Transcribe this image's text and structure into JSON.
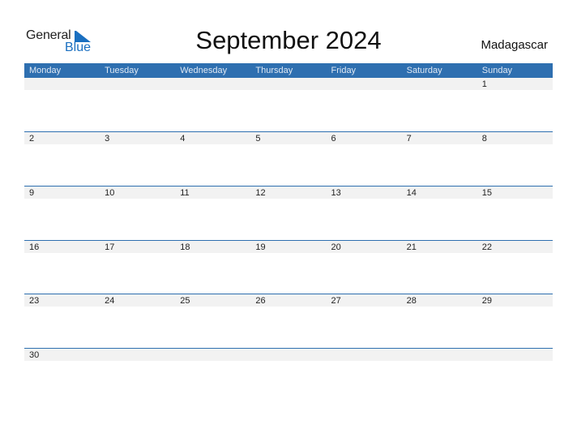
{
  "logo": {
    "line1": "General",
    "line2": "Blue",
    "icon": "triangle-flag-icon",
    "color": "#1a6fc0"
  },
  "title": "September 2024",
  "country": "Madagascar",
  "accent_color": "#2e6fb0",
  "weekdays": [
    "Monday",
    "Tuesday",
    "Wednesday",
    "Thursday",
    "Friday",
    "Saturday",
    "Sunday"
  ],
  "weeks": [
    [
      "",
      "",
      "",
      "",
      "",
      "",
      "1"
    ],
    [
      "2",
      "3",
      "4",
      "5",
      "6",
      "7",
      "8"
    ],
    [
      "9",
      "10",
      "11",
      "12",
      "13",
      "14",
      "15"
    ],
    [
      "16",
      "17",
      "18",
      "19",
      "20",
      "21",
      "22"
    ],
    [
      "23",
      "24",
      "25",
      "26",
      "27",
      "28",
      "29"
    ],
    [
      "30",
      "",
      "",
      "",
      "",
      "",
      ""
    ]
  ]
}
